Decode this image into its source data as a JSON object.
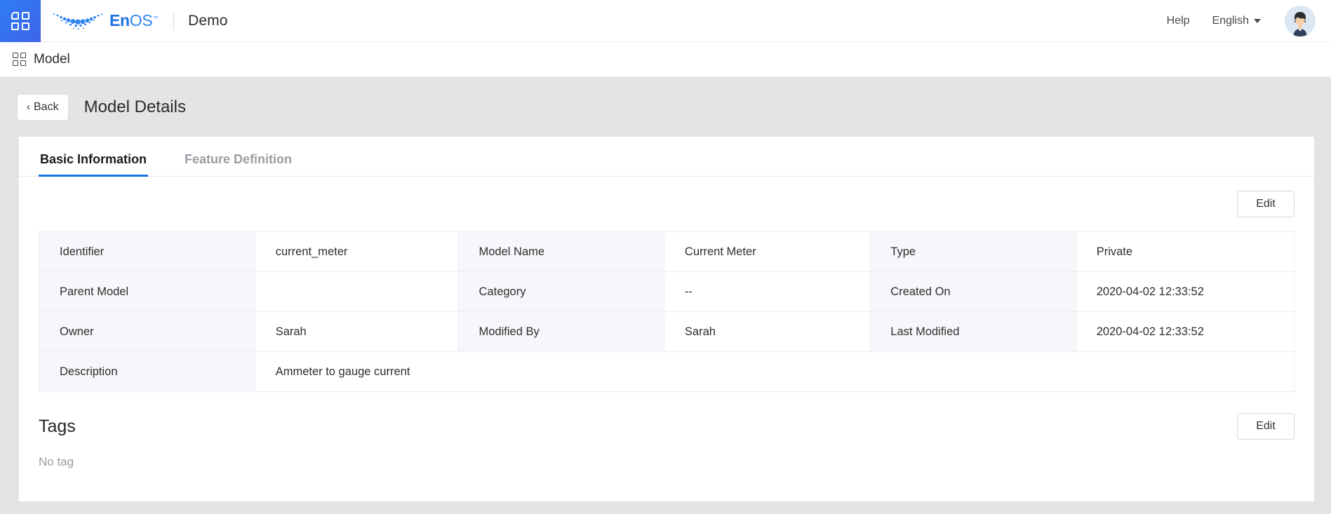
{
  "header": {
    "launcher_icon": "app-grid-icon",
    "brand_name_bold": "En",
    "brand_name_light": "OS",
    "brand_tm": "™",
    "tenant": "Demo",
    "help_label": "Help",
    "language_label": "English",
    "avatar_icon": "user-avatar"
  },
  "breadcrumb": {
    "icon": "model-grid-icon",
    "label": "Model"
  },
  "page": {
    "back_label": "Back",
    "back_chevron": "‹",
    "title": "Model Details"
  },
  "tabs": [
    {
      "label": "Basic Information",
      "active": true
    },
    {
      "label": "Feature Definition",
      "active": false
    }
  ],
  "actions": {
    "edit_basic_label": "Edit",
    "edit_tags_label": "Edit"
  },
  "info_table": {
    "rows": [
      [
        {
          "type": "label",
          "text": "Identifier"
        },
        {
          "type": "value",
          "text": "current_meter"
        },
        {
          "type": "label",
          "text": "Model Name"
        },
        {
          "type": "value",
          "text": "Current Meter"
        },
        {
          "type": "label",
          "text": "Type"
        },
        {
          "type": "value",
          "text": "Private"
        }
      ],
      [
        {
          "type": "label",
          "text": "Parent Model"
        },
        {
          "type": "value",
          "text": ""
        },
        {
          "type": "label",
          "text": "Category"
        },
        {
          "type": "value",
          "text": "--"
        },
        {
          "type": "label",
          "text": "Created On"
        },
        {
          "type": "value",
          "text": "2020-04-02 12:33:52"
        }
      ],
      [
        {
          "type": "label",
          "text": "Owner"
        },
        {
          "type": "value",
          "text": "Sarah"
        },
        {
          "type": "label",
          "text": "Modified By"
        },
        {
          "type": "value",
          "text": "Sarah"
        },
        {
          "type": "label",
          "text": "Last Modified"
        },
        {
          "type": "value",
          "text": "2020-04-02 12:33:52"
        }
      ],
      [
        {
          "type": "label",
          "text": "Description"
        },
        {
          "type": "value",
          "text": "Ammeter to gauge current",
          "span": 5
        }
      ]
    ]
  },
  "tags": {
    "title": "Tags",
    "empty_text": "No tag"
  },
  "colors": {
    "accent": "#1a73e8",
    "brand_blue": "#1f6fe5",
    "page_bg": "#e4e4e4",
    "label_cell_bg": "#f6f7fa",
    "muted_text": "#9a9aa2"
  }
}
